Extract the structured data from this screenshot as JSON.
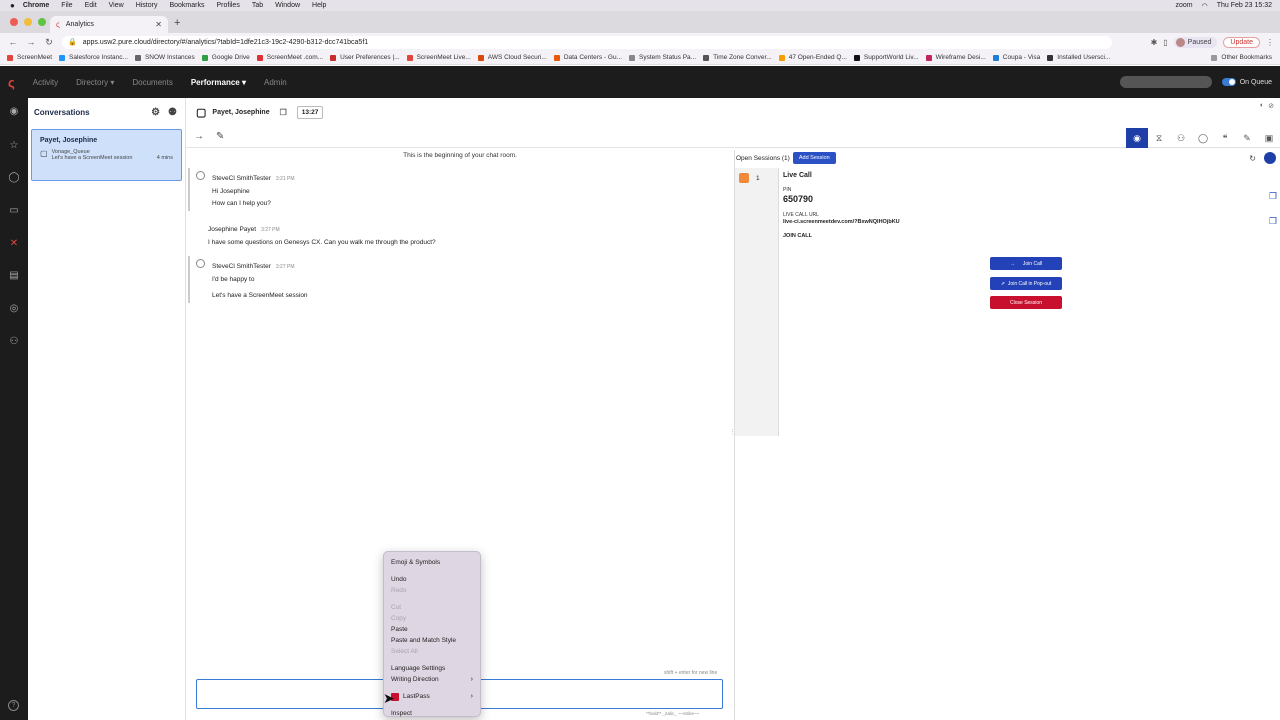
{
  "menubar": {
    "app": "Chrome",
    "items": [
      "File",
      "Edit",
      "View",
      "History",
      "Bookmarks",
      "Profiles",
      "Tab",
      "Window",
      "Help"
    ],
    "zoom": "zoom",
    "clock": "Thu Feb 23  15:32"
  },
  "tab": {
    "title": "Analytics"
  },
  "address": {
    "url": "apps.usw2.pure.cloud/directory/#/analytics/?tabId=1dfe21c3-19c2-4290-b312-dcc741bca5f1",
    "paused": "Paused",
    "update": "Update"
  },
  "bookmarks": [
    "ScreenMeet",
    "Salesforce Instanc...",
    "SNOW Instances",
    "Google Drive",
    "ScreenMeet .com...",
    "User Preferences |...",
    "ScreenMeet Live...",
    "AWS Cloud Securi...",
    "Data Centers - Gu...",
    "System Status Pa...",
    "Time Zone Conver...",
    "47 Open-Ended Q...",
    "SupportWorld Liv...",
    "Wireframe Desi...",
    "Coupa - Visa",
    "Installed Usersci..."
  ],
  "other_bookmarks": "Other Bookmarks",
  "appnav": {
    "items": [
      "Activity",
      "Directory",
      "Documents",
      "Performance",
      "Admin"
    ],
    "active": "Performance",
    "queue": "On Queue"
  },
  "conversations": {
    "title": "Conversations",
    "card": {
      "name": "Payet, Josephine",
      "queue": "Vonage_Queue",
      "preview": "Let's have a ScreenMeet session",
      "age": "4 mins"
    }
  },
  "chat": {
    "participant": "Payet, Josephine",
    "timer": "13:27",
    "beginning": "This is the beginning of your chat room.",
    "messages": [
      {
        "sender": "SteveCl SmithTester",
        "time": "3:21 PM",
        "lines": [
          "Hi Josephine",
          "How can I help you?"
        ]
      },
      {
        "sender": "Josephine Payet",
        "time": "3:27 PM",
        "lines": [
          "I have some questions on Genesys CX. Can you walk me through the product?"
        ]
      },
      {
        "sender": "SteveCl SmithTester",
        "time": "3:27 PM",
        "lines": [
          "I'd be happy to",
          "Let's have a ScreenMeet session"
        ]
      }
    ],
    "hint_newline": "shift + enter for new line",
    "hint_format": "**bold** _italic_ ~~strike~~"
  },
  "sessions": {
    "open_label": "Open Sessions (1)",
    "add_label": "Add Session",
    "list_number": "1",
    "title": "Live Call",
    "pin_label": "PIN",
    "pin": "650790",
    "url_label": "LIVE CALL URL",
    "url": "live-ci.screenmeetdev.com/?BxwNQIHOjbKU",
    "join_label": "JOIN CALL",
    "btn_join": "Join Call",
    "btn_popout": "Join Call in Pop-out",
    "btn_close": "Close Session"
  },
  "context_menu": {
    "emoji": "Emoji & Symbols",
    "undo": "Undo",
    "redo": "Redo",
    "cut": "Cut",
    "copy": "Copy",
    "paste": "Paste",
    "paste_match": "Paste and Match Style",
    "select_all": "Select All",
    "language": "Language Settings",
    "writing": "Writing Direction",
    "lastpass": "LastPass",
    "inspect": "Inspect"
  },
  "colors": {
    "accent": "#2b51c4",
    "danger": "#c8102e",
    "nav_bg": "#1c1c1c",
    "selected_card": "#cfe0fb"
  }
}
